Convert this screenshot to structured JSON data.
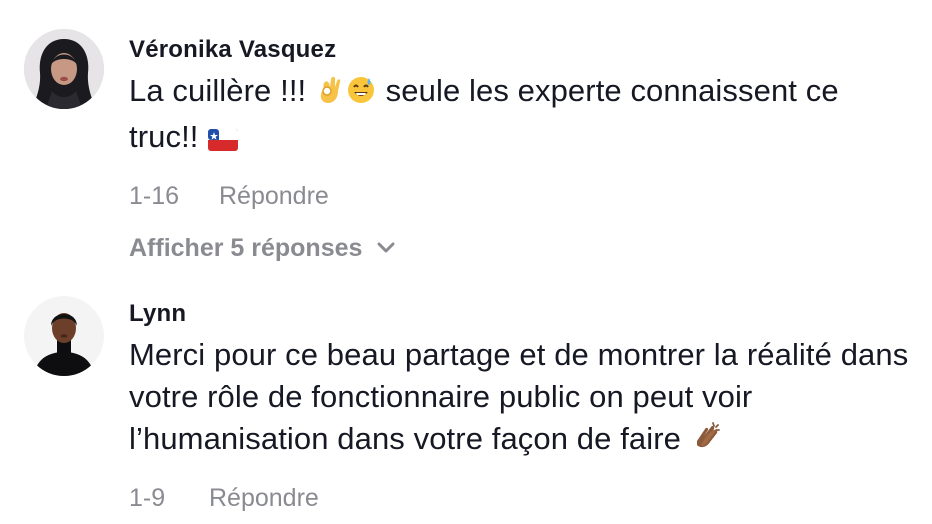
{
  "comments": [
    {
      "username": "Véronika Vasquez",
      "text_before_emoji": "La cuillère !!! ",
      "text_after_emoji": " seule les experte connaissent ce truc!! ",
      "emojis": [
        "ok-hand-emoji",
        "sweat-smile-emoji",
        "chile-flag-emoji"
      ],
      "date": "1-16",
      "reply_label": "Répondre",
      "view_replies_label": "Afficher 5 réponses"
    },
    {
      "username": "Lynn",
      "text": "Merci pour ce beau partage et de montrer la réalité dans votre rôle de fonctionnaire public on peut voir l’humanisation dans votre façon de faire ",
      "emojis": [
        "clapping-hands-emoji"
      ],
      "date": "1-9",
      "reply_label": "Répondre"
    }
  ],
  "colors": {
    "text_primary": "#161823",
    "text_secondary": "#8a8b91",
    "background": "#ffffff"
  }
}
